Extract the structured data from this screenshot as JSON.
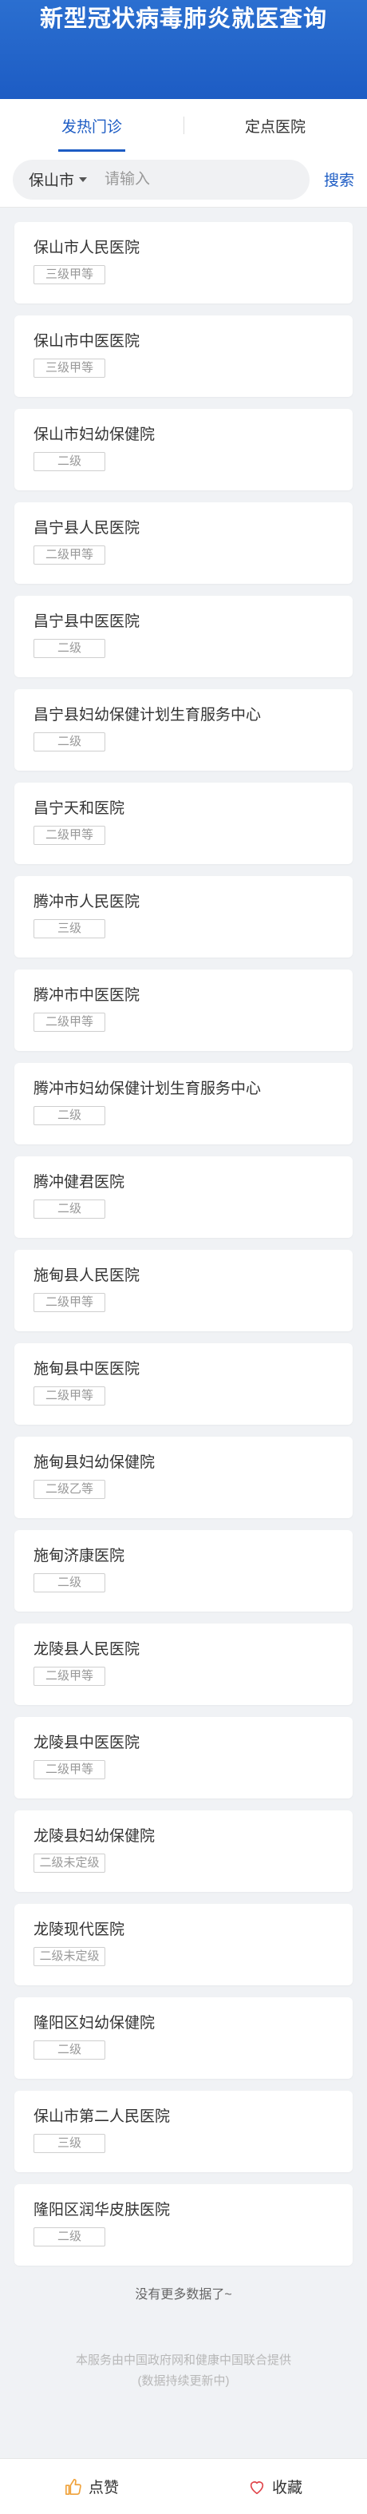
{
  "header": {
    "title": "新型冠状病毒肺炎就医查询"
  },
  "tabs": [
    {
      "label": "发热门诊",
      "active": true
    },
    {
      "label": "定点医院",
      "active": false
    }
  ],
  "search": {
    "city": "保山市",
    "placeholder": "请输入",
    "value": "",
    "button_label": "搜索"
  },
  "hospitals": [
    {
      "name": "保山市人民医院",
      "level": "三级甲等"
    },
    {
      "name": "保山市中医医院",
      "level": "三级甲等"
    },
    {
      "name": "保山市妇幼保健院",
      "level": "二级"
    },
    {
      "name": "昌宁县人民医院",
      "level": "二级甲等"
    },
    {
      "name": "昌宁县中医医院",
      "level": "二级"
    },
    {
      "name": "昌宁县妇幼保健计划生育服务中心",
      "level": "二级"
    },
    {
      "name": "昌宁天和医院",
      "level": "二级甲等"
    },
    {
      "name": "腾冲市人民医院",
      "level": "三级"
    },
    {
      "name": "腾冲市中医医院",
      "level": "二级甲等"
    },
    {
      "name": "腾冲市妇幼保健计划生育服务中心",
      "level": "二级"
    },
    {
      "name": "腾冲健君医院",
      "level": "二级"
    },
    {
      "name": "施甸县人民医院",
      "level": "二级甲等"
    },
    {
      "name": "施甸县中医医院",
      "level": "二级甲等"
    },
    {
      "name": "施甸县妇幼保健院",
      "level": "二级乙等"
    },
    {
      "name": "施甸济康医院",
      "level": "二级"
    },
    {
      "name": "龙陵县人民医院",
      "level": "二级甲等"
    },
    {
      "name": "龙陵县中医医院",
      "level": "二级甲等"
    },
    {
      "name": "龙陵县妇幼保健院",
      "level": "二级未定级"
    },
    {
      "name": "龙陵现代医院",
      "level": "二级未定级"
    },
    {
      "name": "隆阳区妇幼保健院",
      "level": "二级"
    },
    {
      "name": "保山市第二人民医院",
      "level": "三级"
    },
    {
      "name": "隆阳区润华皮肤医院",
      "level": "二级"
    }
  ],
  "footer": {
    "end_text": "没有更多数据了~",
    "source_line1": "本服务由中国政府网和健康中国联合提供",
    "source_line2": "(数据持续更新中)"
  },
  "bottom_bar": {
    "like_label": "点赞",
    "like_icon": "thumbs-up-icon",
    "favorite_label": "收藏",
    "favorite_icon": "heart-icon"
  },
  "colors": {
    "brand": "#1d5cc4",
    "like_icon": "#f0a23b",
    "favorite_icon": "#e0464c"
  }
}
